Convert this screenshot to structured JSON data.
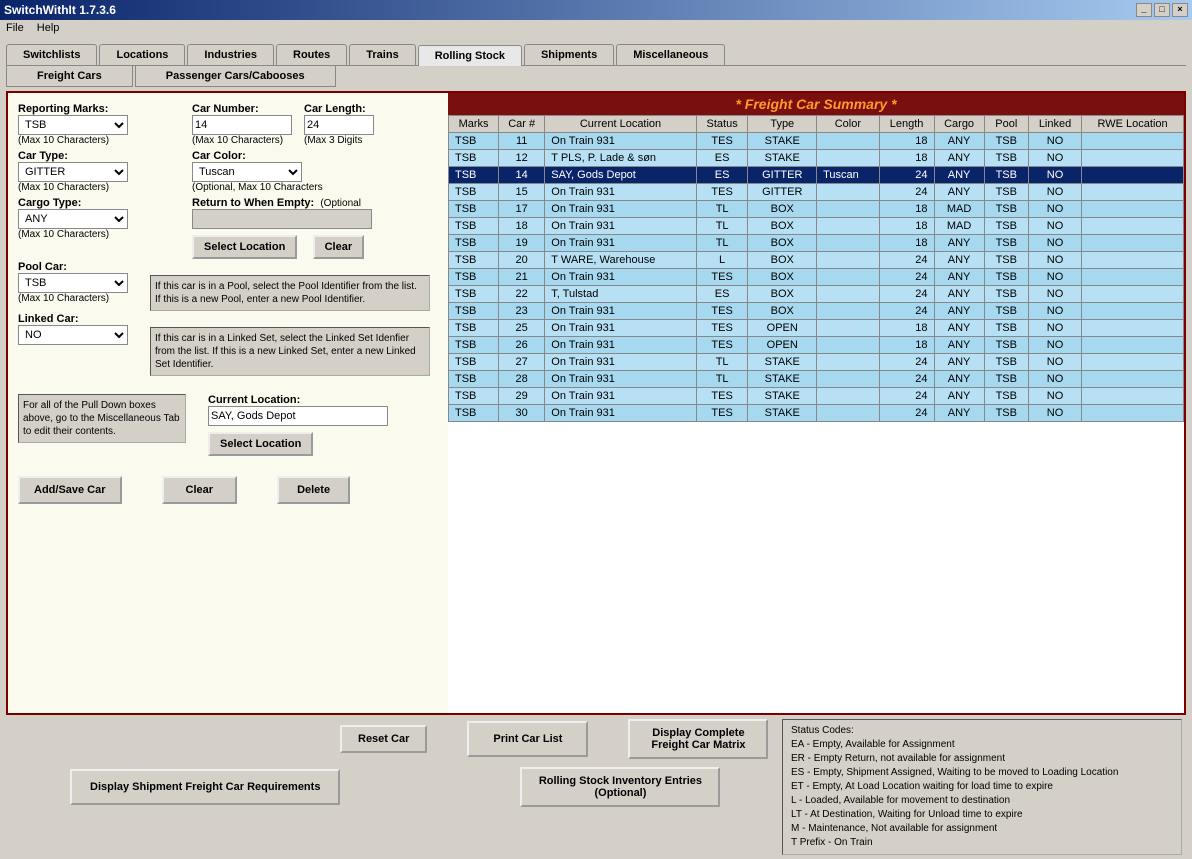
{
  "window": {
    "title": "SwitchWithIt 1.7.3.6"
  },
  "menu": {
    "file": "File",
    "help": "Help"
  },
  "main_tabs": [
    "Switchlists",
    "Locations",
    "Industries",
    "Routes",
    "Trains",
    "Rolling Stock",
    "Shipments",
    "Miscellaneous"
  ],
  "main_tab_active": 5,
  "sub_tabs": [
    "Freight Cars",
    "Passenger Cars/Cabooses"
  ],
  "sub_tab_active": 0,
  "form": {
    "reporting_marks": {
      "label": "Reporting Marks:",
      "value": "TSB",
      "hint": "(Max 10 Characters)"
    },
    "car_number": {
      "label": "Car Number:",
      "value": "14",
      "hint": "(Max 10 Characters)"
    },
    "car_length": {
      "label": "Car Length:",
      "value": "24",
      "hint": "(Max 3 Digits"
    },
    "car_type": {
      "label": "Car Type:",
      "value": "GITTER",
      "hint": "(Max 10 Characters)"
    },
    "car_color": {
      "label": "Car Color:",
      "value": "Tuscan",
      "hint": "(Optional, Max 10 Characters"
    },
    "cargo_type": {
      "label": "Cargo Type:",
      "value": "ANY",
      "hint": "(Max 10 Characters)"
    },
    "return_empty": {
      "label": "Return to When Empty:",
      "hint": "(Optional",
      "value": ""
    },
    "select_location_btn": "Select Location",
    "clear_btn": "Clear",
    "pool_car": {
      "label": "Pool Car:",
      "value": "TSB",
      "hint": "(Max 10 Characters)"
    },
    "pool_help": "If this car is in a Pool, select the Pool Identifier from the list.  If this is a new Pool, enter a new Pool Identifier.",
    "linked_car": {
      "label": "Linked Car:",
      "value": "NO"
    },
    "linked_help": "If this car is in a Linked Set, select the Linked Set Idenfier from the list.  If this is a new Linked Set, enter a new Linked Set Identifier.",
    "pulldown_note": "For all of the Pull Down boxes above, go to the Miscellaneous Tab to edit their contents.",
    "current_location": {
      "label": "Current Location:",
      "value": "SAY, Gods Depot"
    },
    "select_location_btn2": "Select Location",
    "add_save": "Add/Save Car",
    "clear2": "Clear",
    "delete": "Delete"
  },
  "summary": {
    "title": "* Freight Car Summary *",
    "columns": [
      "Marks",
      "Car #",
      "Current Location",
      "Status",
      "Type",
      "Color",
      "Length",
      "Cargo",
      "Pool",
      "Linked",
      "RWE Location"
    ],
    "rows": [
      {
        "marks": "TSB",
        "num": "11",
        "loc": "On Train 931",
        "status": "TES",
        "type": "STAKE",
        "color": "",
        "len": "18",
        "cargo": "ANY",
        "pool": "TSB",
        "linked": "NO",
        "rwe": ""
      },
      {
        "marks": "TSB",
        "num": "12",
        "loc": "T PLS, P. Lade & søn",
        "status": "ES",
        "type": "STAKE",
        "color": "",
        "len": "18",
        "cargo": "ANY",
        "pool": "TSB",
        "linked": "NO",
        "rwe": ""
      },
      {
        "marks": "TSB",
        "num": "14",
        "loc": "SAY, Gods Depot",
        "status": "ES",
        "type": "GITTER",
        "color": "Tuscan",
        "len": "24",
        "cargo": "ANY",
        "pool": "TSB",
        "linked": "NO",
        "rwe": "",
        "selected": true
      },
      {
        "marks": "TSB",
        "num": "15",
        "loc": "On Train 931",
        "status": "TES",
        "type": "GITTER",
        "color": "",
        "len": "24",
        "cargo": "ANY",
        "pool": "TSB",
        "linked": "NO",
        "rwe": ""
      },
      {
        "marks": "TSB",
        "num": "17",
        "loc": "On Train 931",
        "status": "TL",
        "type": "BOX",
        "color": "",
        "len": "18",
        "cargo": "MAD",
        "pool": "TSB",
        "linked": "NO",
        "rwe": ""
      },
      {
        "marks": "TSB",
        "num": "18",
        "loc": "On Train 931",
        "status": "TL",
        "type": "BOX",
        "color": "",
        "len": "18",
        "cargo": "MAD",
        "pool": "TSB",
        "linked": "NO",
        "rwe": ""
      },
      {
        "marks": "TSB",
        "num": "19",
        "loc": "On Train 931",
        "status": "TL",
        "type": "BOX",
        "color": "",
        "len": "18",
        "cargo": "ANY",
        "pool": "TSB",
        "linked": "NO",
        "rwe": ""
      },
      {
        "marks": "TSB",
        "num": "20",
        "loc": "T WARE, Warehouse",
        "status": "L",
        "type": "BOX",
        "color": "",
        "len": "24",
        "cargo": "ANY",
        "pool": "TSB",
        "linked": "NO",
        "rwe": ""
      },
      {
        "marks": "TSB",
        "num": "21",
        "loc": "On Train 931",
        "status": "TES",
        "type": "BOX",
        "color": "",
        "len": "24",
        "cargo": "ANY",
        "pool": "TSB",
        "linked": "NO",
        "rwe": ""
      },
      {
        "marks": "TSB",
        "num": "22",
        "loc": "T, Tulstad",
        "status": "ES",
        "type": "BOX",
        "color": "",
        "len": "24",
        "cargo": "ANY",
        "pool": "TSB",
        "linked": "NO",
        "rwe": ""
      },
      {
        "marks": "TSB",
        "num": "23",
        "loc": "On Train 931",
        "status": "TES",
        "type": "BOX",
        "color": "",
        "len": "24",
        "cargo": "ANY",
        "pool": "TSB",
        "linked": "NO",
        "rwe": ""
      },
      {
        "marks": "TSB",
        "num": "25",
        "loc": "On Train 931",
        "status": "TES",
        "type": "OPEN",
        "color": "",
        "len": "18",
        "cargo": "ANY",
        "pool": "TSB",
        "linked": "NO",
        "rwe": ""
      },
      {
        "marks": "TSB",
        "num": "26",
        "loc": "On Train 931",
        "status": "TES",
        "type": "OPEN",
        "color": "",
        "len": "18",
        "cargo": "ANY",
        "pool": "TSB",
        "linked": "NO",
        "rwe": ""
      },
      {
        "marks": "TSB",
        "num": "27",
        "loc": "On Train 931",
        "status": "TL",
        "type": "STAKE",
        "color": "",
        "len": "24",
        "cargo": "ANY",
        "pool": "TSB",
        "linked": "NO",
        "rwe": ""
      },
      {
        "marks": "TSB",
        "num": "28",
        "loc": "On Train 931",
        "status": "TL",
        "type": "STAKE",
        "color": "",
        "len": "24",
        "cargo": "ANY",
        "pool": "TSB",
        "linked": "NO",
        "rwe": ""
      },
      {
        "marks": "TSB",
        "num": "29",
        "loc": "On Train 931",
        "status": "TES",
        "type": "STAKE",
        "color": "",
        "len": "24",
        "cargo": "ANY",
        "pool": "TSB",
        "linked": "NO",
        "rwe": ""
      },
      {
        "marks": "TSB",
        "num": "30",
        "loc": "On Train 931",
        "status": "TES",
        "type": "STAKE",
        "color": "",
        "len": "24",
        "cargo": "ANY",
        "pool": "TSB",
        "linked": "NO",
        "rwe": ""
      }
    ]
  },
  "lower_buttons": {
    "reset_car": "Reset Car",
    "print_car_list": "Print Car List",
    "display_matrix": "Display Complete Freight Car Matrix",
    "display_req": "Display Shipment Freight Car Requirements",
    "inventory": "Rolling Stock Inventory Entries (Optional)"
  },
  "status_codes": {
    "title": "Status Codes:",
    "lines": [
      "EA - Empty, Available for Assignment",
      "ER - Empty Return, not available for assignment",
      "ES - Empty, Shipment Assigned, Waiting to be moved to Loading Location",
      "ET - Empty, At Load Location waiting for load time to expire",
      "L - Loaded, Available for movement to destination",
      "LT - At Destination, Waiting for Unload time to expire",
      "M - Maintenance, Not available for assignment",
      "T Prefix - On Train"
    ]
  }
}
